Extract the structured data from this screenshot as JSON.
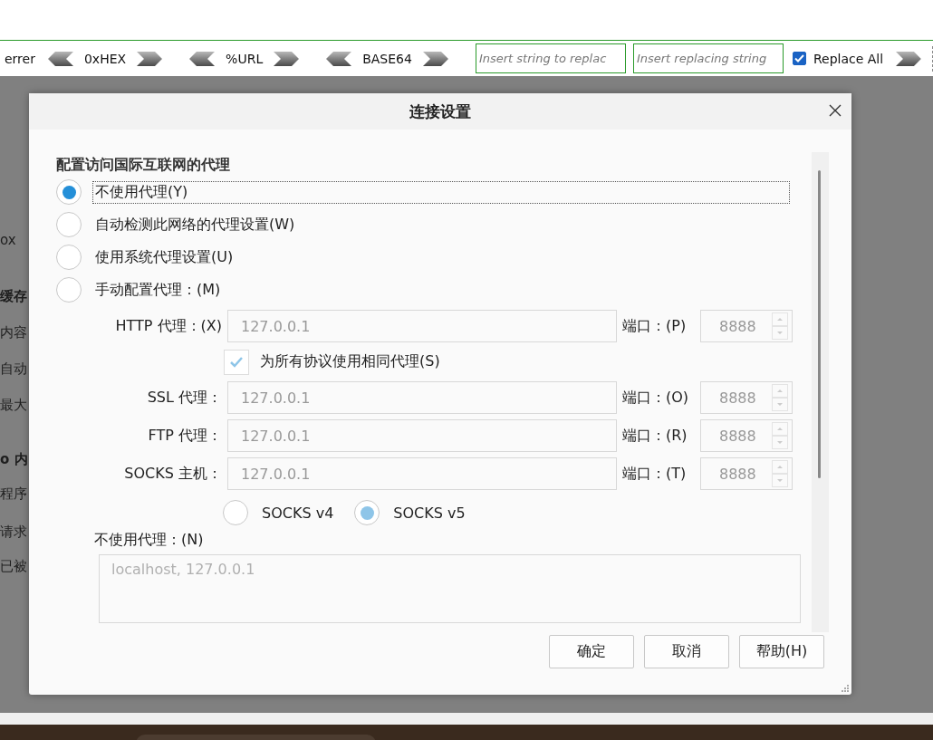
{
  "toolbar": {
    "leading_text": "errer",
    "converters": [
      {
        "label": "0xHEX"
      },
      {
        "label": "%URL"
      },
      {
        "label": "BASE64"
      }
    ],
    "find_field": {
      "placeholder": "Insert string to replac"
    },
    "replace_field": {
      "placeholder": "Insert replacing string"
    },
    "replace_all": {
      "label": "Replace All",
      "checked": true
    }
  },
  "background_page": {
    "fragments": [
      {
        "text": "ox",
        "bold": false
      },
      {
        "text": "缓存",
        "bold": true
      },
      {
        "text": "内容",
        "bold": false
      },
      {
        "text": "自动",
        "bold": false
      },
      {
        "text": "最大",
        "bold": false
      },
      {
        "text": "o 内",
        "bold": true
      },
      {
        "text": "程序",
        "bold": false
      },
      {
        "text": "请求",
        "bold": false
      },
      {
        "text": "已被",
        "bold": false
      }
    ]
  },
  "dialog": {
    "title": "连接设置",
    "heading": "配置访问国际互联网的代理",
    "proxy_modes": [
      {
        "label": "不使用代理(Y)",
        "selected": true,
        "focused": true
      },
      {
        "label": "自动检测此网络的代理设置(W)",
        "selected": false,
        "focused": false
      },
      {
        "label": "使用系统代理设置(U)",
        "selected": false,
        "focused": false
      },
      {
        "label": "手动配置代理：(M)",
        "selected": false,
        "focused": false
      }
    ],
    "manual_disabled": true,
    "proxies": [
      {
        "label": "HTTP 代理：(X)",
        "value": "127.0.0.1",
        "port_label": "端口：(P)",
        "port": "8888"
      },
      {
        "label": "SSL 代理：",
        "value": "127.0.0.1",
        "port_label": "端口：(O)",
        "port": "8888"
      },
      {
        "label": "FTP 代理：",
        "value": "127.0.0.1",
        "port_label": "端口：(R)",
        "port": "8888"
      },
      {
        "label": "SOCKS 主机：",
        "value": "127.0.0.1",
        "port_label": "端口：(T)",
        "port": "8888"
      }
    ],
    "same_proxy": {
      "label": "为所有协议使用相同代理(S)",
      "checked": true
    },
    "socks_versions": [
      {
        "label": "SOCKS v4",
        "selected": false
      },
      {
        "label": "SOCKS v5",
        "selected": true
      }
    ],
    "no_proxy": {
      "label": "不使用代理：(N)",
      "placeholder": "localhost, 127.0.0.1"
    },
    "buttons": [
      "确定",
      "取消",
      "帮助(H)"
    ]
  }
}
